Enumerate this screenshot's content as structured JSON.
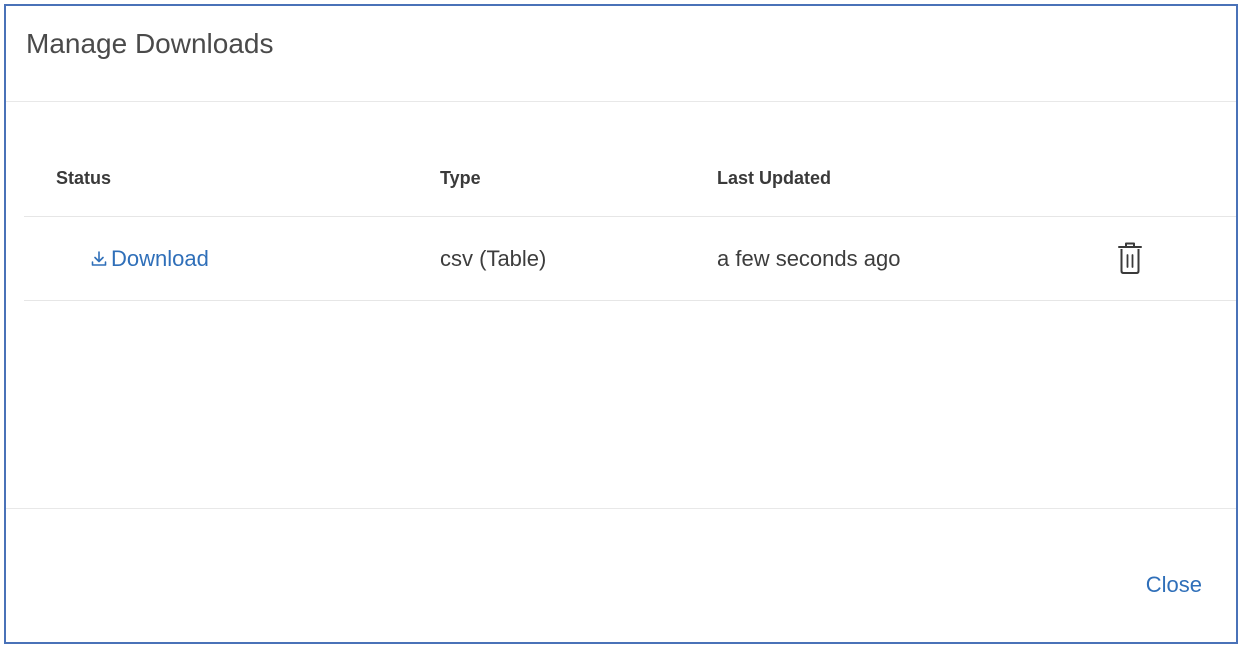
{
  "dialog": {
    "title": "Manage Downloads"
  },
  "table": {
    "columns": {
      "status": "Status",
      "type": "Type",
      "last_updated": "Last Updated"
    },
    "rows": [
      {
        "status_label": "Download",
        "status_icon": "download-icon",
        "type": "csv (Table)",
        "last_updated": "a few seconds ago",
        "action_icon": "trash-icon"
      }
    ]
  },
  "footer": {
    "close_label": "Close"
  },
  "colors": {
    "accent": "#2f6fb9",
    "border": "#4a72b8",
    "text": "#3d3d3d"
  }
}
